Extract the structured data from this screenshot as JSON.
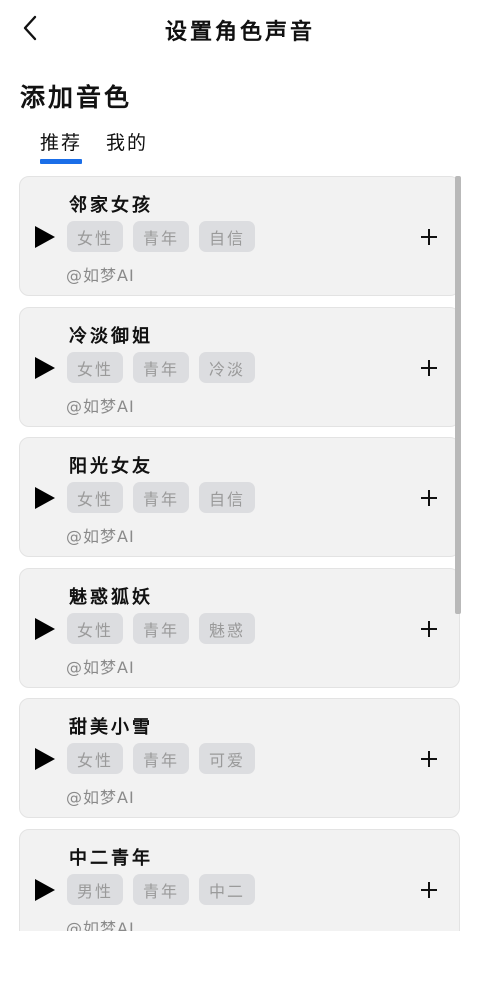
{
  "header": {
    "title": "设置角色声音"
  },
  "section": {
    "title": "添加音色"
  },
  "tabs": [
    {
      "label": "推荐"
    },
    {
      "label": "我的"
    }
  ],
  "voices": [
    {
      "name": "邻家女孩",
      "tags": [
        "女性",
        "青年",
        "自信"
      ],
      "author": "@如梦AI"
    },
    {
      "name": "冷淡御姐",
      "tags": [
        "女性",
        "青年",
        "冷淡"
      ],
      "author": "@如梦AI"
    },
    {
      "name": "阳光女友",
      "tags": [
        "女性",
        "青年",
        "自信"
      ],
      "author": "@如梦AI"
    },
    {
      "name": "魅惑狐妖",
      "tags": [
        "女性",
        "青年",
        "魅惑"
      ],
      "author": "@如梦AI"
    },
    {
      "name": "甜美小雪",
      "tags": [
        "女性",
        "青年",
        "可爱"
      ],
      "author": "@如梦AI"
    },
    {
      "name": "中二青年",
      "tags": [
        "男性",
        "青年",
        "中二"
      ],
      "author": "@如梦AI"
    }
  ],
  "colors": {
    "accent": "#1a6ee8",
    "card_bg": "#f2f2f2",
    "tag_bg": "#dcdde0"
  },
  "icons": {
    "back": "chevron-left-icon",
    "play": "play-icon",
    "add": "plus-icon"
  }
}
